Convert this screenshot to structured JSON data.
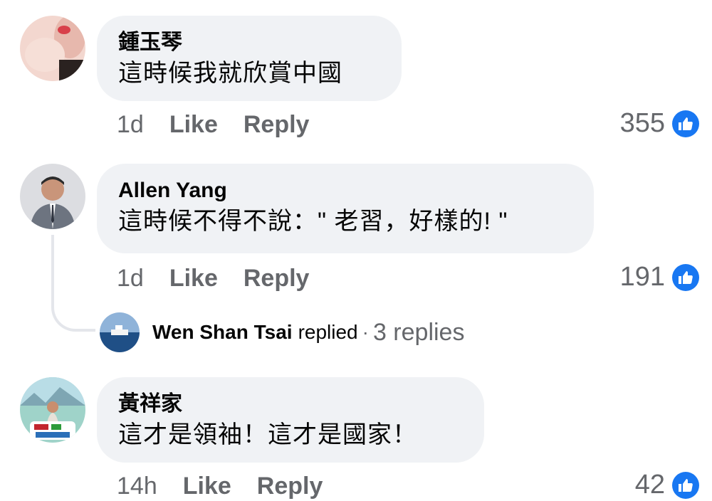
{
  "comments": [
    {
      "author": "鍾玉琴",
      "text": "這時候我就欣賞中國",
      "time": "1d",
      "like_label": "Like",
      "reply_label": "Reply",
      "reactions": "355",
      "reaction_icon": "thumbs-up-icon"
    },
    {
      "author": "Allen Yang",
      "text": "這時候不得不說：\" 老習，好樣的! \"",
      "time": "1d",
      "like_label": "Like",
      "reply_label": "Reply",
      "reactions": "191",
      "reaction_icon": "thumbs-up-icon",
      "reply_summary": {
        "name": "Wen Shan Tsai",
        "action": "replied",
        "separator": "·",
        "count_label": "3 replies"
      }
    },
    {
      "author": "黃祥家",
      "text": "這才是領袖！這才是國家！",
      "time": "14h",
      "like_label": "Like",
      "reply_label": "Reply",
      "reactions": "42",
      "reaction_icon": "thumbs-up-icon"
    }
  ],
  "colors": {
    "bubble": "#f0f2f5",
    "meta_text": "#65676b",
    "like_blue": "#1877f2"
  }
}
